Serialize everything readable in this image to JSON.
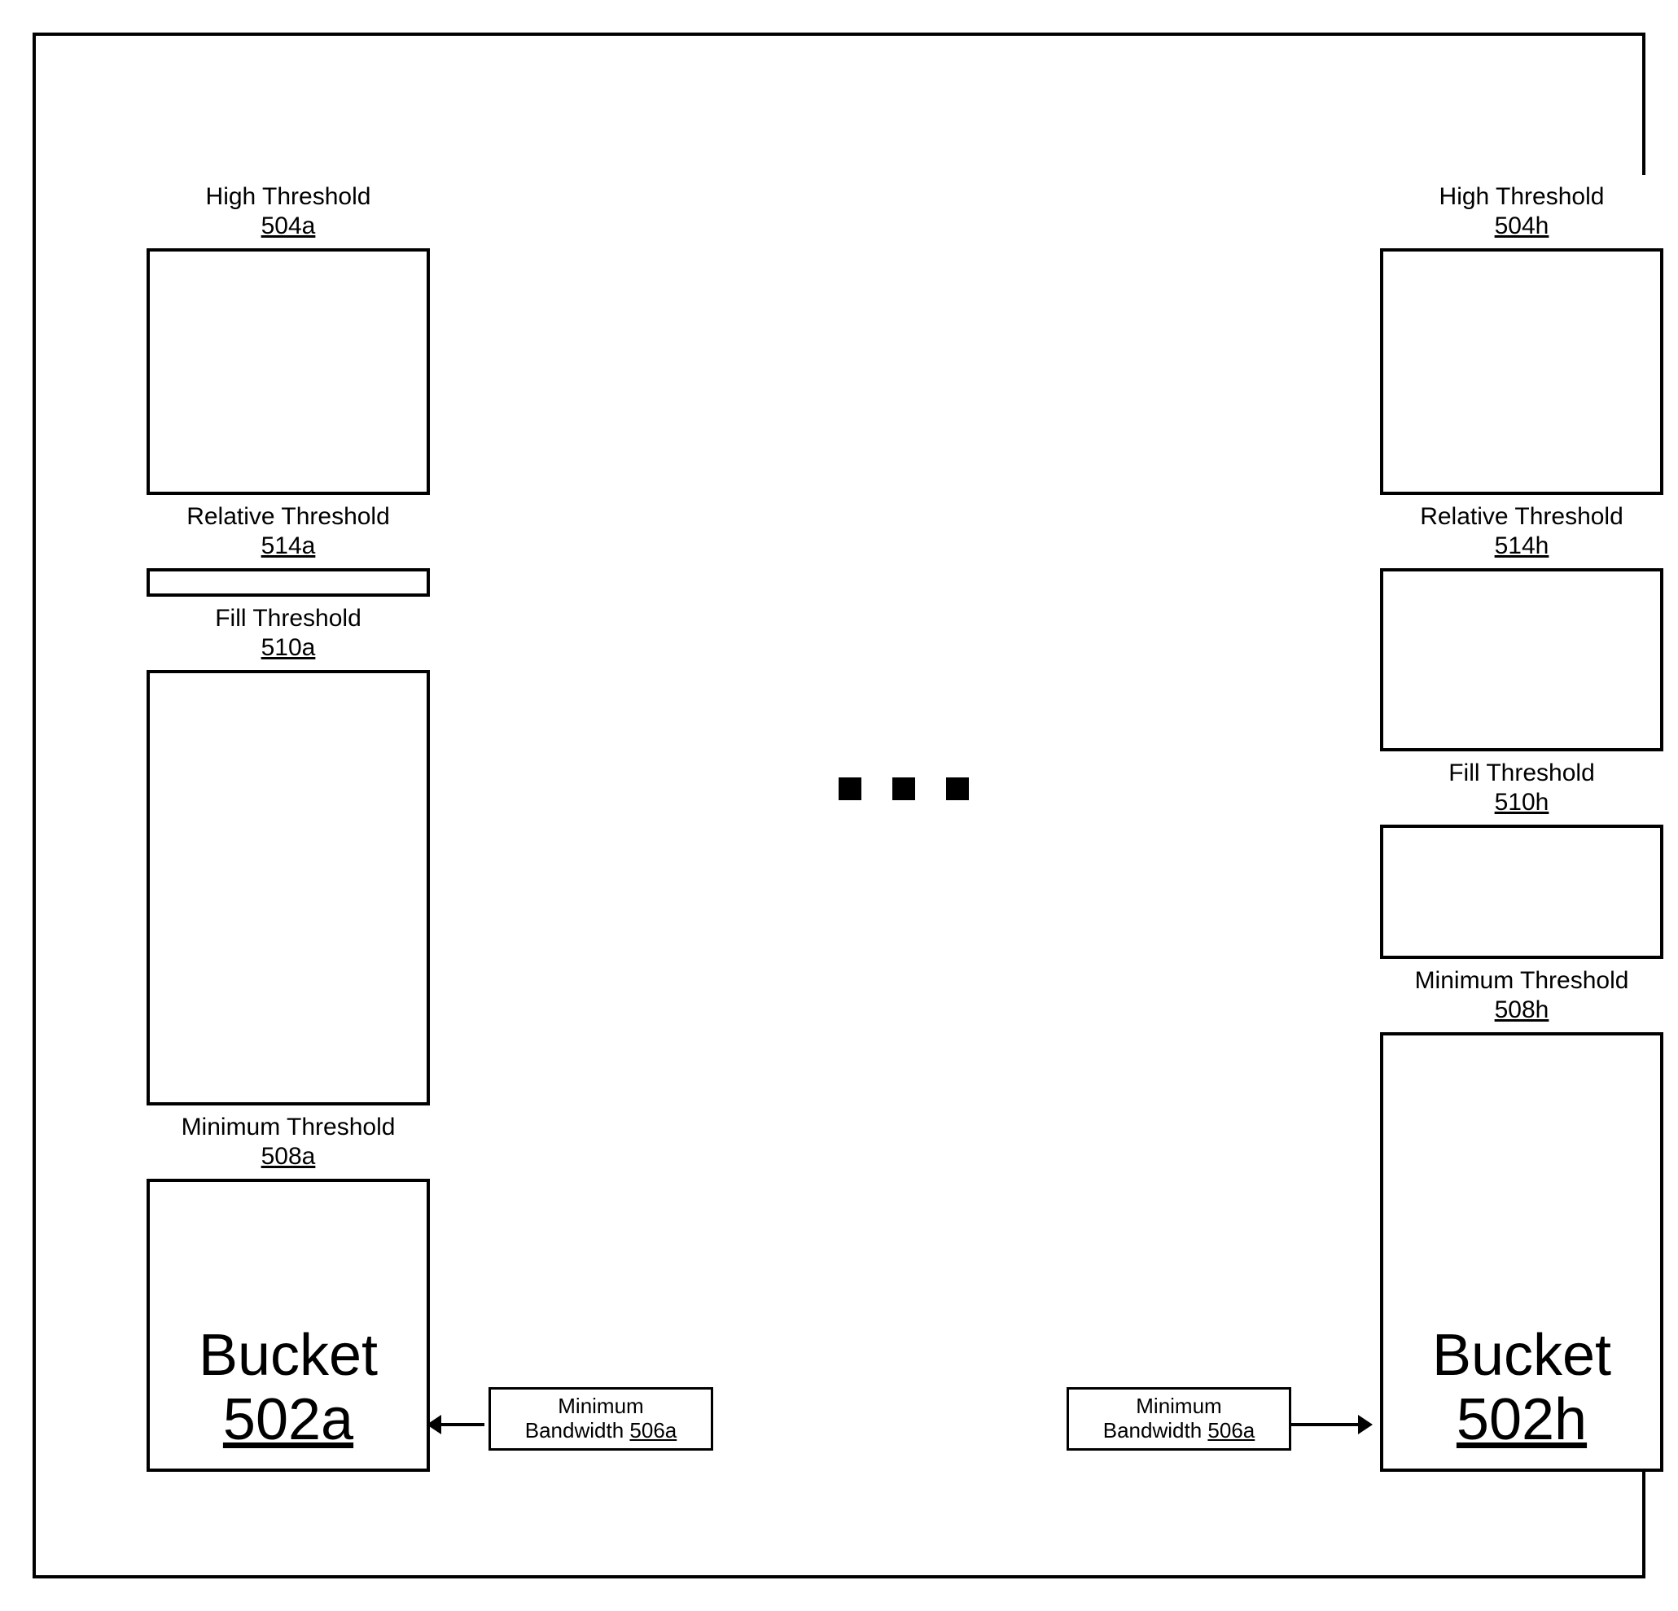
{
  "bucketA": {
    "high": {
      "label": "High Threshold",
      "ref": "504a"
    },
    "rel": {
      "label": "Relative Threshold",
      "ref": "514a"
    },
    "fill": {
      "label": "Fill Threshold",
      "ref": "510a"
    },
    "min": {
      "label": "Minimum Threshold",
      "ref": "508a"
    },
    "title": {
      "label": "Bucket",
      "ref": "502a"
    },
    "minbw": {
      "label": "Minimum",
      "label2": "Bandwidth ",
      "ref": "506a"
    }
  },
  "bucketH": {
    "high": {
      "label": "High Threshold",
      "ref": "504h"
    },
    "rel": {
      "label": "Relative Threshold",
      "ref": "514h"
    },
    "fill": {
      "label": "Fill Threshold",
      "ref": "510h"
    },
    "min": {
      "label": "Minimum Threshold",
      "ref": "508h"
    },
    "title": {
      "label": "Bucket",
      "ref": "502h"
    },
    "minbw": {
      "label": "Minimum",
      "label2": "Bandwidth ",
      "ref": "506a"
    }
  }
}
